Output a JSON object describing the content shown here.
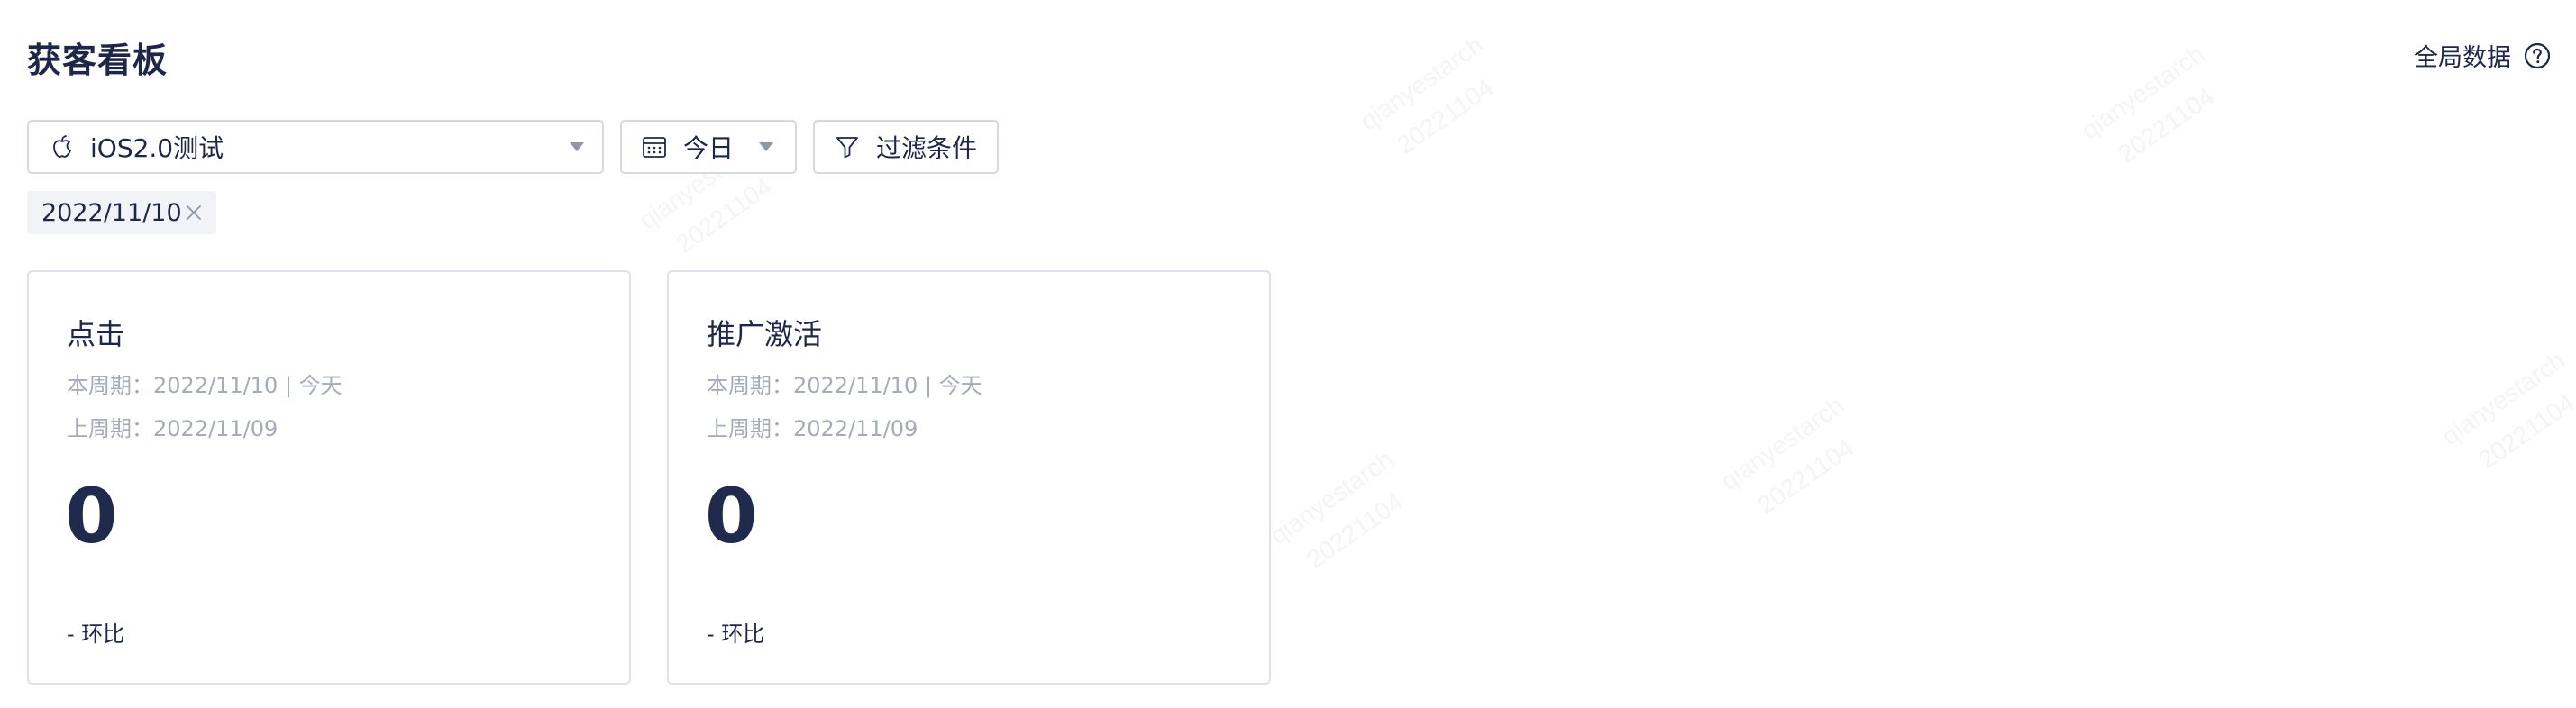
{
  "header": {
    "title": "获客看板",
    "global_data_label": "全局数据"
  },
  "filters": {
    "app_select": {
      "value": "iOS2.0测试",
      "icon": "apple-icon"
    },
    "date_select": {
      "value": "今日",
      "icon": "calendar-icon"
    },
    "filter_button": {
      "label": "过滤条件",
      "icon": "filter-icon"
    }
  },
  "active_tags": [
    {
      "label": "2022/11/10"
    }
  ],
  "cards": [
    {
      "title": "点击",
      "current_period": "本周期：2022/11/10 | 今天",
      "previous_period": "上周期：2022/11/09",
      "value": "0",
      "compare": "- 环比"
    },
    {
      "title": "推广激活",
      "current_period": "本周期：2022/11/10 | 今天",
      "previous_period": "上周期：2022/11/09",
      "value": "0",
      "compare": "- 环比"
    }
  ],
  "watermark": {
    "user": "qianyestarch",
    "date": "20221104"
  },
  "colors": {
    "text_primary": "#1f2748",
    "text_muted": "#a6abb8",
    "border": "#d5d9e2",
    "tag_bg": "#f1f3f7"
  }
}
